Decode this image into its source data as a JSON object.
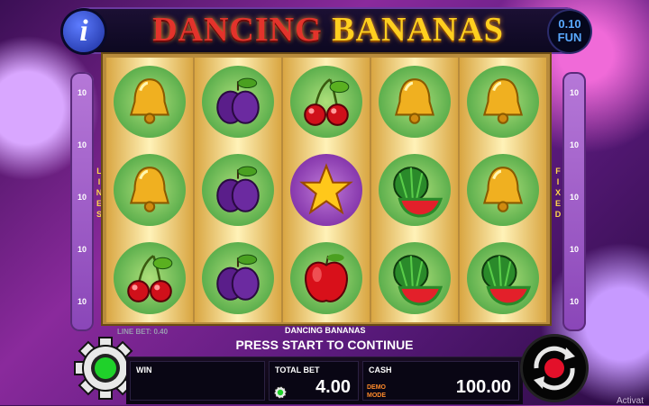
{
  "header": {
    "info_symbol": "i",
    "title_word1": "DANCING",
    "title_word2": "BANANAS",
    "denom_value": "0.10",
    "denom_mode": "FUN"
  },
  "reels": {
    "symbols": [
      [
        "bell",
        "plum",
        "cherry",
        "bell",
        "bell"
      ],
      [
        "bell",
        "plum",
        "star",
        "watermelon",
        "bell"
      ],
      [
        "cherry",
        "plum",
        "apple",
        "watermelon",
        "watermelon"
      ]
    ]
  },
  "left_sidebar": {
    "numbers": [
      "10",
      "10",
      "10",
      "10",
      "10"
    ],
    "label_letters": [
      "L",
      "I",
      "N",
      "E",
      "S"
    ]
  },
  "right_sidebar": {
    "numbers": [
      "10",
      "10",
      "10",
      "10",
      "10"
    ],
    "label_letters": [
      "F",
      "I",
      "X",
      "E",
      "D"
    ]
  },
  "line_bet": "LINE BET: 0.40",
  "game_name": "DANCING BANANAS",
  "status": "PRESS START TO CONTINUE",
  "bottom": {
    "win_label": "WIN",
    "win_value": "",
    "total_bet_label": "TOTAL BET",
    "total_bet_value": "4.00",
    "cash_label": "CASH",
    "cash_mode": "DEMO MODE",
    "cash_value": "100.00"
  },
  "watermark": "Activat",
  "colors": {
    "title_red": "#e3332b",
    "title_gold": "#ffcf1f",
    "accent_green": "#1fd12a",
    "spin_red": "#e3102a"
  }
}
